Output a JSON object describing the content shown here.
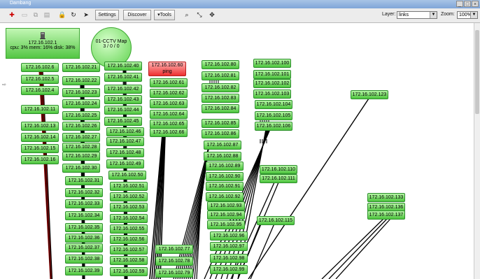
{
  "window": {
    "title": "Dambang",
    "controls": [
      "_",
      "□",
      "×"
    ]
  },
  "toolbar": {
    "settings_label": "Settings",
    "discover_label": "Discover",
    "tools_label": "Tools",
    "layer_label": "Layer:",
    "layer_value": "links",
    "zoom_label": "Zoom:",
    "zoom_value": "100%"
  },
  "server": {
    "name": "172.16.102.1",
    "stats": "cpu: 3% mem: 16% disk: 38%"
  },
  "submap": {
    "name": "01-CCTV Map",
    "counts": "3 / 0 / 0"
  },
  "nodes": [
    {
      "id": "6",
      "label": "172.16.102.6",
      "status": "up"
    },
    {
      "id": "5",
      "label": "172.16.102.5",
      "status": "up"
    },
    {
      "id": "4",
      "label": "172.16.102.4",
      "status": "up"
    },
    {
      "id": "11",
      "label": "172.16.102.11",
      "status": "up"
    },
    {
      "id": "13",
      "label": "172.16.102.13",
      "status": "up"
    },
    {
      "id": "14",
      "label": "172.16.102.14",
      "status": "up"
    },
    {
      "id": "15",
      "label": "172.16.102.15",
      "status": "up"
    },
    {
      "id": "16",
      "label": "172.16.102.16",
      "status": "up"
    },
    {
      "id": "21",
      "label": "172.16.102.21",
      "status": "up"
    },
    {
      "id": "22",
      "label": "172.16.102.22",
      "status": "up"
    },
    {
      "id": "23",
      "label": "172.16.102.23",
      "status": "up"
    },
    {
      "id": "24",
      "label": "172.16.102.24",
      "status": "up"
    },
    {
      "id": "25",
      "label": "172.16.102.25",
      "status": "up"
    },
    {
      "id": "26",
      "label": "172.16.102.26",
      "status": "up"
    },
    {
      "id": "27",
      "label": "172.16.102.27",
      "status": "up"
    },
    {
      "id": "28",
      "label": "172.16.102.28",
      "status": "up"
    },
    {
      "id": "29",
      "label": "172.16.102.29",
      "status": "up"
    },
    {
      "id": "30",
      "label": "172.16.102.30",
      "status": "up"
    },
    {
      "id": "31",
      "label": "172.16.102.31",
      "status": "up"
    },
    {
      "id": "32",
      "label": "172.16.102.32",
      "status": "up"
    },
    {
      "id": "33",
      "label": "172.16.102.33",
      "status": "up"
    },
    {
      "id": "34",
      "label": "172.16.102.34",
      "status": "up"
    },
    {
      "id": "35",
      "label": "172.16.102.35",
      "status": "up"
    },
    {
      "id": "36",
      "label": "172.16.102.36",
      "status": "up"
    },
    {
      "id": "37",
      "label": "172.16.102.37",
      "status": "up"
    },
    {
      "id": "38",
      "label": "172.16.102.38",
      "status": "up"
    },
    {
      "id": "39",
      "label": "172.16.102.39",
      "status": "up"
    },
    {
      "id": "40",
      "label": "172.16.102.40",
      "status": "up"
    },
    {
      "id": "41",
      "label": "172.16.102.41",
      "status": "up"
    },
    {
      "id": "42",
      "label": "172.16.102.42",
      "status": "up"
    },
    {
      "id": "43",
      "label": "172.16.102.43",
      "status": "up"
    },
    {
      "id": "44",
      "label": "172.16.102.44",
      "status": "up"
    },
    {
      "id": "45",
      "label": "172.16.102.45",
      "status": "up"
    },
    {
      "id": "46",
      "label": "172.16.102.46",
      "status": "up"
    },
    {
      "id": "47",
      "label": "172.16.102.47",
      "status": "up"
    },
    {
      "id": "48",
      "label": "172.16.102.48",
      "status": "up"
    },
    {
      "id": "49",
      "label": "172.16.102.49",
      "status": "up"
    },
    {
      "id": "50",
      "label": "172.16.102.50",
      "status": "up"
    },
    {
      "id": "51",
      "label": "172.16.102.51",
      "status": "up"
    },
    {
      "id": "52",
      "label": "172.16.102.52",
      "status": "up"
    },
    {
      "id": "53",
      "label": "172.16.102.53",
      "status": "up"
    },
    {
      "id": "54",
      "label": "172.16.102.54",
      "status": "up"
    },
    {
      "id": "55",
      "label": "172.16.102.55",
      "status": "up"
    },
    {
      "id": "56",
      "label": "172.16.102.56",
      "status": "up"
    },
    {
      "id": "57",
      "label": "172.16.102.57",
      "status": "up"
    },
    {
      "id": "58",
      "label": "172.16.102.58",
      "status": "up"
    },
    {
      "id": "59",
      "label": "172.16.102.59",
      "status": "up"
    },
    {
      "id": "60",
      "label": "172.16.102.60",
      "sublabel": "ping",
      "status": "down"
    },
    {
      "id": "61",
      "label": "172.16.102.61",
      "status": "up"
    },
    {
      "id": "62",
      "label": "172.16.102.62",
      "status": "up"
    },
    {
      "id": "63",
      "label": "172.16.102.63",
      "status": "up"
    },
    {
      "id": "64",
      "label": "172.16.102.64",
      "status": "up"
    },
    {
      "id": "65",
      "label": "172.16.102.65",
      "status": "up"
    },
    {
      "id": "66",
      "label": "172.16.102.66",
      "status": "up"
    },
    {
      "id": "77",
      "label": "172.16.102.77",
      "status": "up"
    },
    {
      "id": "78",
      "label": "172.16.102.78",
      "status": "up"
    },
    {
      "id": "79",
      "label": "172.16.102.79",
      "status": "up"
    },
    {
      "id": "80",
      "label": "172.16.102.80",
      "status": "up"
    },
    {
      "id": "81",
      "label": "172.16.102.81",
      "status": "up"
    },
    {
      "id": "82",
      "label": "172.16.102.82",
      "status": "up"
    },
    {
      "id": "83",
      "label": "172.16.102.83",
      "status": "up"
    },
    {
      "id": "84",
      "label": "172.16.102.84",
      "status": "up"
    },
    {
      "id": "85",
      "label": "172.16.102.85",
      "status": "up"
    },
    {
      "id": "86",
      "label": "172.16.102.86",
      "status": "up"
    },
    {
      "id": "87",
      "label": "172.16.102.87",
      "status": "up"
    },
    {
      "id": "88",
      "label": "172.16.102.88",
      "status": "up"
    },
    {
      "id": "89",
      "label": "172.16.102.89",
      "status": "up"
    },
    {
      "id": "90",
      "label": "172.16.102.90",
      "status": "up"
    },
    {
      "id": "91",
      "label": "172.16.102.91",
      "status": "up"
    },
    {
      "id": "92",
      "label": "172.16.102.92",
      "status": "up"
    },
    {
      "id": "93",
      "label": "172.16.102.93",
      "status": "up"
    },
    {
      "id": "94",
      "label": "172.16.102.94",
      "status": "up"
    },
    {
      "id": "95",
      "label": "172.16.102.95",
      "status": "up"
    },
    {
      "id": "96",
      "label": "172.16.102.96",
      "status": "up"
    },
    {
      "id": "97",
      "label": "172.16.102.97",
      "status": "up"
    },
    {
      "id": "98",
      "label": "172.16.102.98",
      "status": "up"
    },
    {
      "id": "99",
      "label": "172.16.102.99",
      "status": "up"
    },
    {
      "id": "100",
      "label": "172.16.102.100",
      "status": "up"
    },
    {
      "id": "101",
      "label": "172.16.102.101",
      "status": "up"
    },
    {
      "id": "102",
      "label": "172.16.102.102",
      "status": "up"
    },
    {
      "id": "103",
      "label": "172.16.102.103",
      "status": "up"
    },
    {
      "id": "104",
      "label": "172.16.102.104",
      "status": "up"
    },
    {
      "id": "105",
      "label": "172.16.102.105",
      "status": "up"
    },
    {
      "id": "106",
      "label": "172.16.102.106",
      "status": "up"
    },
    {
      "id": "110",
      "label": "172.16.102.110",
      "status": "up"
    },
    {
      "id": "111",
      "label": "172.16.102.111",
      "status": "up"
    },
    {
      "id": "115",
      "label": "172.16.102.115",
      "status": "up"
    },
    {
      "id": "123",
      "label": "172.16.102.123",
      "status": "up"
    },
    {
      "id": "133",
      "label": "172.16.102.133",
      "status": "up"
    },
    {
      "id": "136",
      "label": "172.16.102.136",
      "status": "up"
    },
    {
      "id": "137",
      "label": "172.16.102.137",
      "status": "up"
    }
  ]
}
